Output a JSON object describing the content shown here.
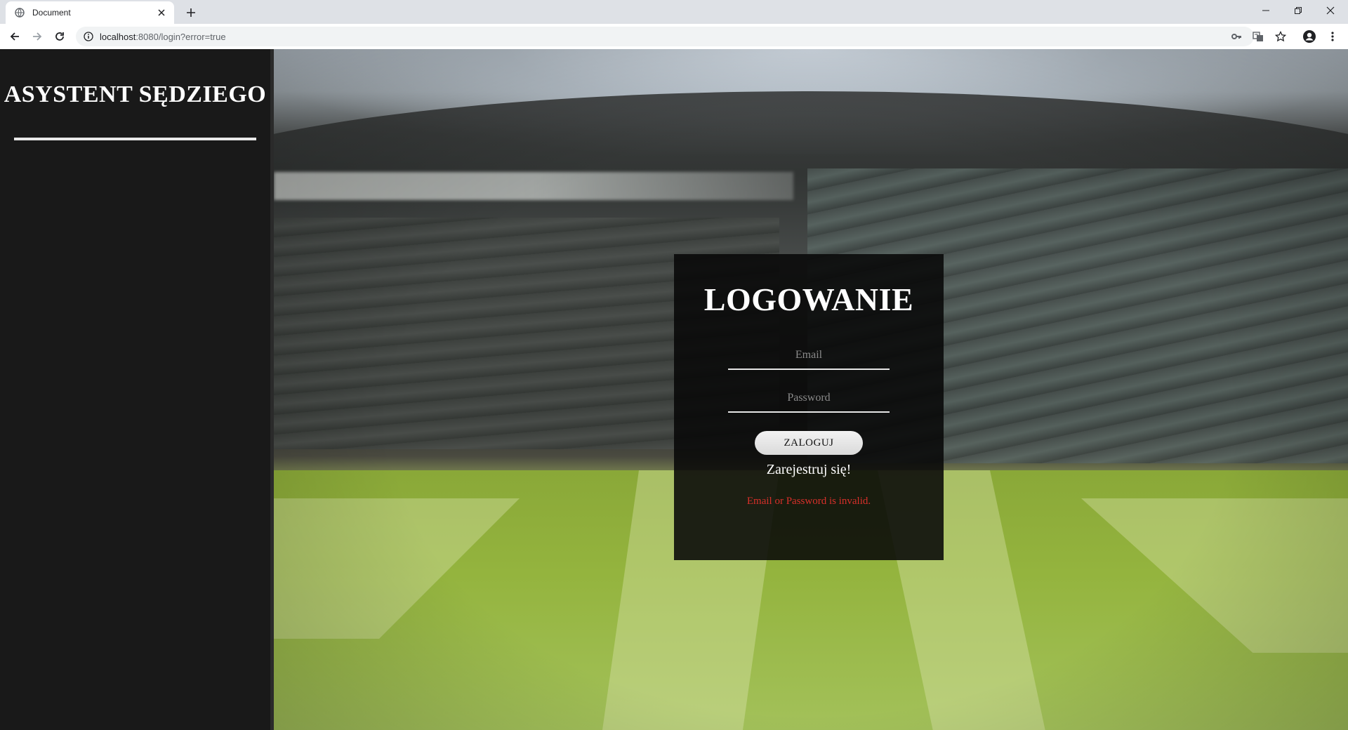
{
  "browser": {
    "tab_title": "Document",
    "url_host": "localhost",
    "url_rest": ":8080/login?error=true",
    "icons": [
      "globe-icon",
      "close-icon",
      "plus-icon",
      "minimize-icon",
      "restore-icon",
      "back-icon",
      "forward-icon",
      "reload-icon",
      "info-icon",
      "key-icon",
      "translate-icon",
      "star-icon",
      "account-icon",
      "menu-icon"
    ]
  },
  "sidebar": {
    "title": "ASYSTENT SĘDZIEGO"
  },
  "login": {
    "title": "LOGOWANIE",
    "email_placeholder": "Email",
    "password_placeholder": "Password",
    "submit_label": "ZALOGUJ",
    "register_label": "Zarejestruj się!",
    "error_message": "Email or Password is invalid."
  },
  "colors": {
    "sidebar_bg": "#191919",
    "box_bg": "#080808",
    "error": "#d9302a",
    "text": "#ffffff"
  }
}
